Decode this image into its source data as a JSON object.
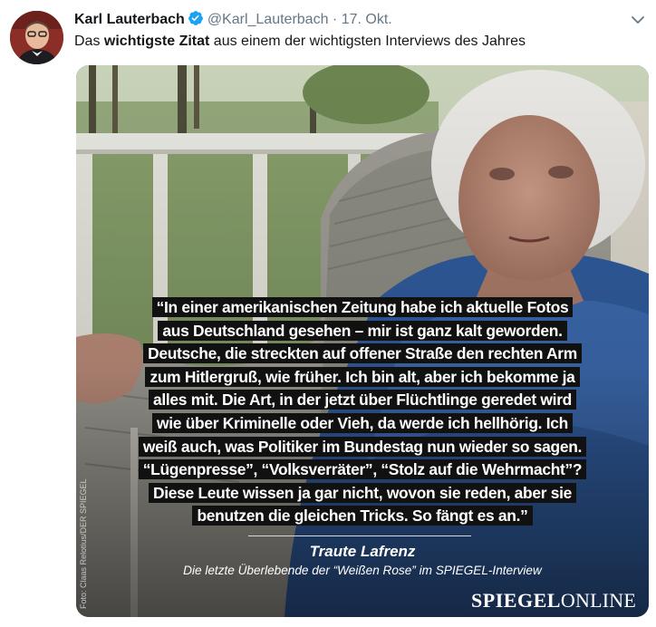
{
  "tweet": {
    "author_name": "Karl Lauterbach",
    "handle": "@Karl_Lauterbach",
    "separator": "·",
    "date": "17. Okt.",
    "text_before": "Das ",
    "text_bold": "wichtigste Zitat",
    "text_after": " aus einem der wichtigsten Interviews des Jahres"
  },
  "media": {
    "quote_lines": [
      "“In einer amerikanischen Zeitung habe ich aktuelle Fotos",
      "aus Deutschland gesehen – mir ist ganz kalt geworden.",
      "Deutsche, die streckten auf offener Straße den rechten Arm",
      "zum Hitlergruß, wie früher. Ich bin alt, aber ich bekomme ja",
      "alles mit. Die Art, in der jetzt über Flüchtlinge geredet wird",
      "wie über Kriminelle oder Vieh, da werde ich hellhörig. Ich",
      "weiß auch, was Politiker im Bundestag nun wieder so sagen.",
      "“Lügenpresse”, “Volksverräter”, “Stolz auf die Wehrmacht”?",
      "Diese Leute wissen ja gar nicht, wovon sie reden, aber sie",
      "benutzen die gleichen Tricks. So fängt es an.”"
    ],
    "author": "Traute Lafrenz",
    "subtitle": "Die letzte Überlebende der “Weißen Rose” im SPIEGEL-Interview",
    "photo_credit": "Foto: Claas Relotius/DER SPIEGEL",
    "logo_bold": "SPIEGEL",
    "logo_regular": "ONLINE"
  },
  "icons": {
    "verified": "verified-badge-icon",
    "caret": "chevron-down-icon"
  },
  "colors": {
    "verified": "#1da1f2",
    "secondary_text": "#657786",
    "quote_highlight": "#111111"
  }
}
